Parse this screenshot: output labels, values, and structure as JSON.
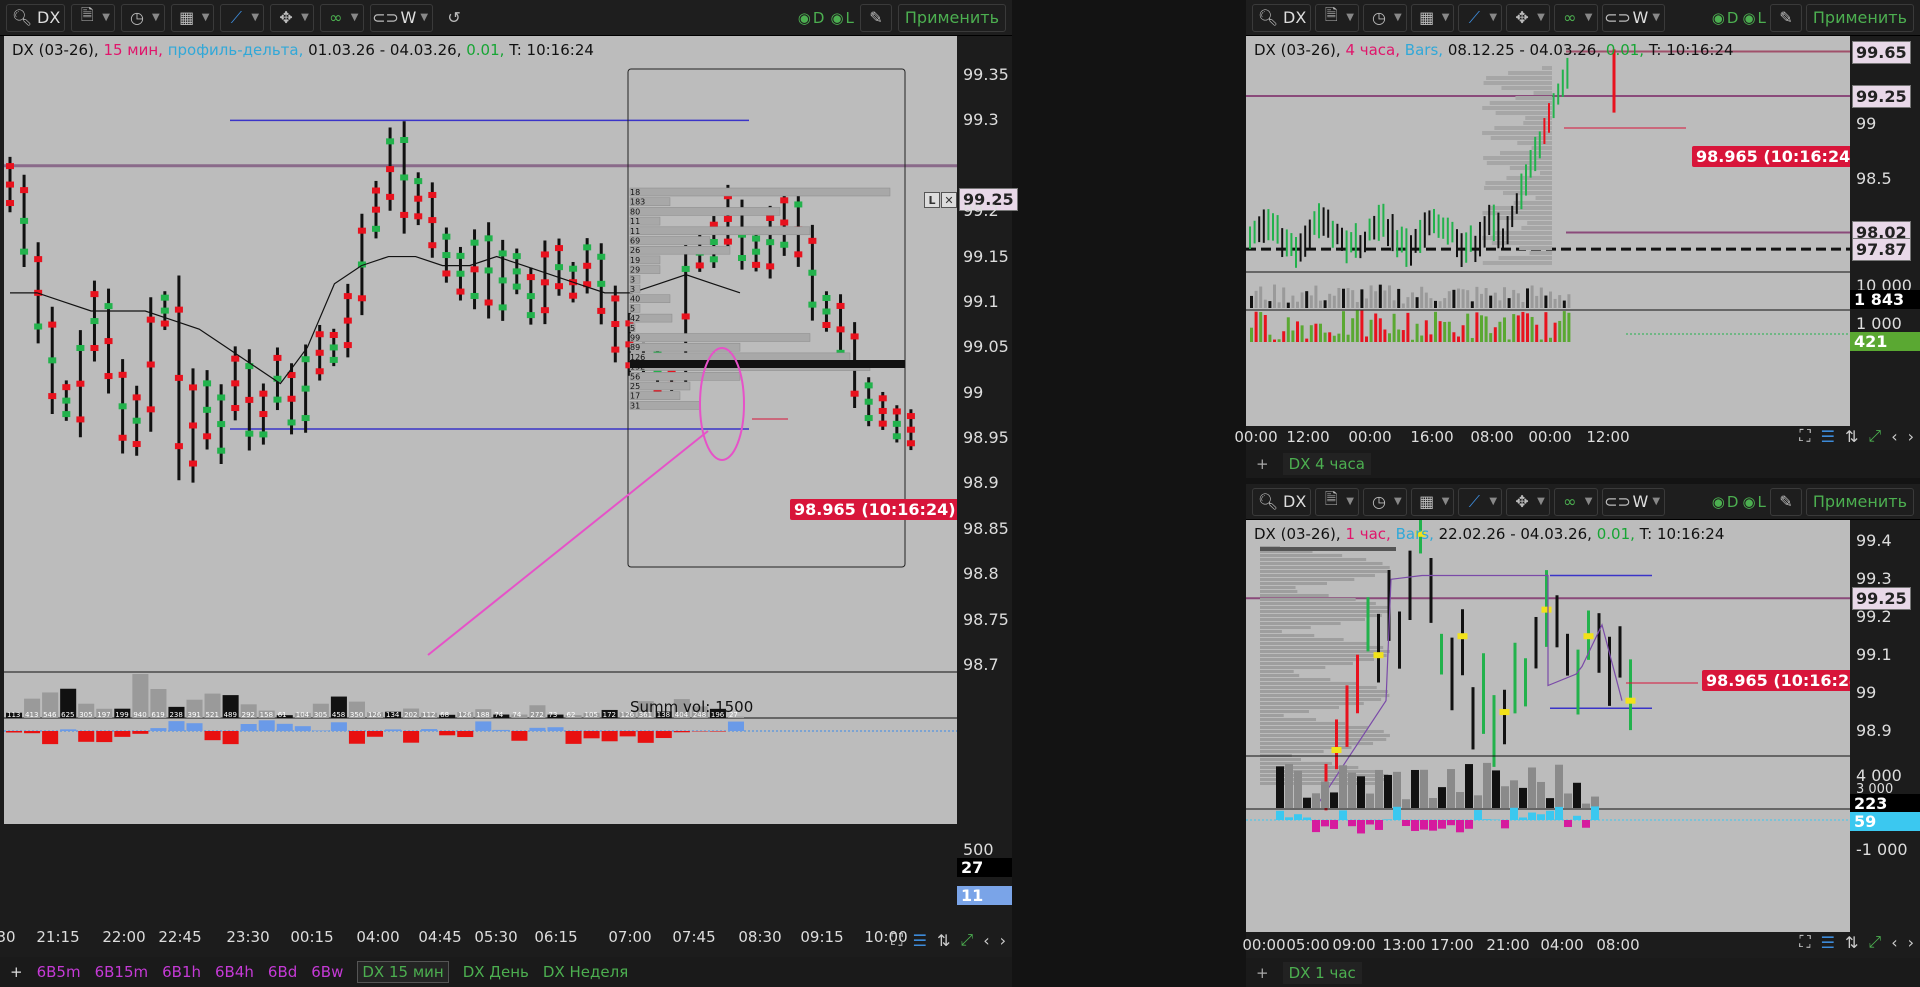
{
  "colors": {
    "accent_green": "#4caf50",
    "accent_blue": "#3d8ad8",
    "bull": "#22b24c",
    "bear": "#e8121e",
    "last_price_bg": "#d8153a",
    "chart_bg": "#bcbcbc",
    "pink_annotation": "#e652c8"
  },
  "toolbar_common": {
    "symbol": "DX",
    "icons": [
      "search-icon",
      "file-icon",
      "clock-icon",
      "calendar-icon",
      "line-chart-icon",
      "crosshair-icon",
      "link-icon",
      "chain-link-icon"
    ],
    "period": "W",
    "vis_d": "D",
    "vis_l": "L",
    "apply": "Применить"
  },
  "main": {
    "header": {
      "symbol": "DX (03-26),",
      "tf": "15 мин,",
      "type": "профиль-дельта,",
      "range": "01.03.26 - 04.03.26,",
      "step": "0.01,",
      "time": "T: 10:16:24"
    },
    "price_ticks": [
      "99.35",
      "99.3",
      "99.25",
      "99.2",
      "99.15",
      "99.1",
      "99.05",
      "99",
      "98.95",
      "98.9",
      "98.85",
      "98.8",
      "98.75",
      "98.7"
    ],
    "time_ticks": [
      "30",
      "21:15",
      "22:00",
      "22:45",
      "23:30",
      "00:15",
      "04:00",
      "04:45",
      "05:30",
      "06:15",
      "07:00",
      "07:45",
      "08:30",
      "09:15",
      "10:00"
    ],
    "last_price": "98.965 (10:16:24)",
    "level_label": "99.25",
    "summ_vol": "Summ vol: 1500",
    "vol_axis_label": "500",
    "vol_last": "27",
    "delta_last": "11",
    "volume_values": [
      "113",
      "413",
      "546",
      "625",
      "305",
      "197",
      "199",
      "940",
      "619",
      "238",
      "391",
      "521",
      "489",
      "292",
      "158",
      "61",
      "104",
      "305",
      "458",
      "350",
      "126",
      "134",
      "202",
      "112",
      "68",
      "126",
      "188",
      "74",
      "74",
      "272",
      "73",
      "62",
      "105",
      "172",
      "126",
      "361",
      "138",
      "404",
      "248",
      "196",
      "27"
    ],
    "profile_values": [
      "18",
      "183",
      "80",
      "11",
      "11",
      "69",
      "26",
      "19",
      "29",
      "3",
      "3",
      "40",
      "5",
      "42",
      "5",
      "99",
      "89",
      "126",
      "152",
      "56",
      "25",
      "17",
      "31"
    ]
  },
  "top_right": {
    "header": {
      "symbol": "DX (03-26),",
      "tf": "4 часа,",
      "type": "Bars,",
      "range": "08.12.25 - 04.03.26,",
      "step": "0.01,",
      "time": "T: 10:16:24"
    },
    "price_ticks": [
      "99.65",
      "99.25",
      "99",
      "98.5",
      "98.02",
      "97.87"
    ],
    "time_ticks": [
      "00:00",
      "12:00",
      "00:00",
      "16:00",
      "08:00",
      "00:00",
      "12:00"
    ],
    "last_price": "98.965 (10:16:24)",
    "vol_labels": [
      "10 000",
      "1 000"
    ],
    "vol_last": "1 843",
    "delta_last": "421",
    "tab": "DX 4 часа"
  },
  "bottom_right": {
    "header": {
      "symbol": "DX (03-26),",
      "tf": "1 час,",
      "type": "Bars,",
      "range": "22.02.26 - 04.03.26,",
      "step": "0.01,",
      "time": "T: 10:16:24"
    },
    "price_ticks": [
      "99.4",
      "99.3",
      "99.25",
      "99.2",
      "99.1",
      "99",
      "98.9"
    ],
    "time_ticks": [
      "00:00",
      "05:00",
      "09:00",
      "13:00",
      "17:00",
      "21:00",
      "04:00",
      "08:00"
    ],
    "last_price": "98.965 (10:16:24)",
    "vol_labels": [
      "4 000",
      "3 000",
      "-1 000"
    ],
    "vol_last": "223",
    "delta_last": "59",
    "tab": "DX 1 час"
  },
  "bottom_tabs": [
    "6B5m",
    "6B15m",
    "6B1h",
    "6B4h",
    "6Bd",
    "6Bw",
    "DX 15 мин",
    "DX День",
    "DX Неделя"
  ],
  "plus": "+",
  "lx_l": "L",
  "lx_x": "✕"
}
